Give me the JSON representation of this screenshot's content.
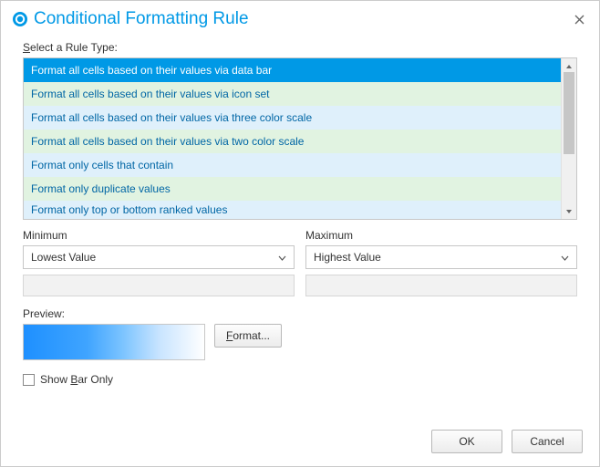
{
  "title": "Conditional Formatting Rule",
  "select_rule_label_pre": "S",
  "select_rule_label_post": "elect a Rule Type:",
  "rules": [
    "Format all cells based on their values via data bar",
    "Format all cells based on their values via icon set",
    "Format all cells based on their values via three color scale",
    "Format all cells based on their values via two color scale",
    "Format only cells that contain",
    "Format only duplicate values",
    "Format only top or bottom ranked values"
  ],
  "minimum_label": "Minimum",
  "maximum_label": "Maximum",
  "minimum_value": "Lowest Value",
  "maximum_value": "Highest Value",
  "preview_label": "Preview:",
  "format_button": "Format...",
  "show_bar_only_pre": "Show ",
  "show_bar_only_u": "B",
  "show_bar_only_post": "ar Only",
  "ok_button": "OK",
  "cancel_button": "Cancel"
}
